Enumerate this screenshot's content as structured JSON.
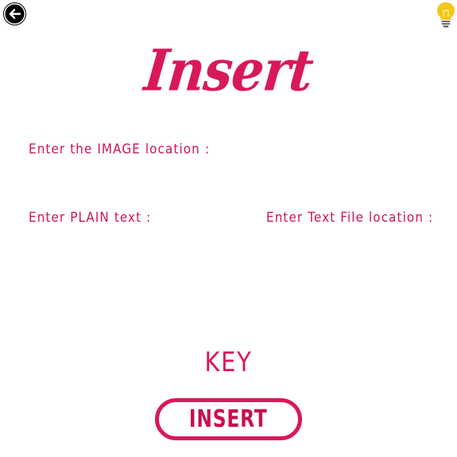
{
  "toolbar": {
    "back_icon": "back-arrow-icon",
    "hint_icon": "lightbulb-icon"
  },
  "header": {
    "title": "Insert"
  },
  "form": {
    "image_location_label": "Enter the IMAGE location :",
    "image_location_value": "",
    "plain_text_label": "Enter PLAIN text :",
    "plain_text_value": "",
    "text_file_label": "Enter Text File location :",
    "text_file_value": "",
    "key_label": "KEY",
    "key_value": ""
  },
  "actions": {
    "insert_label": "INSERT"
  },
  "colors": {
    "accent": "#d9185c",
    "bulb": "#f5c518",
    "icon": "#000000"
  }
}
